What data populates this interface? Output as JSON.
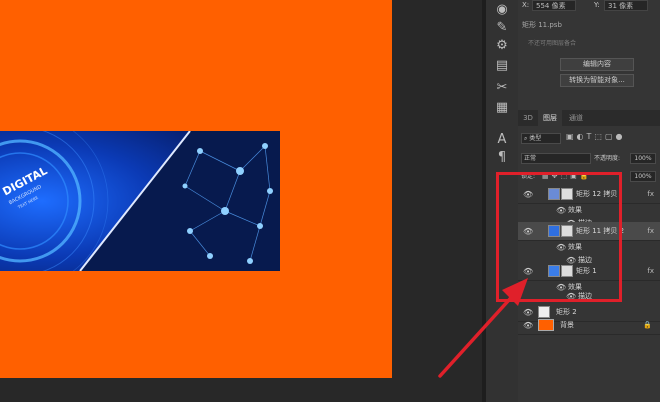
{
  "properties": {
    "x_label": "X:",
    "x_value": "554 像素",
    "y_label": "Y:",
    "y_value": "31 像素",
    "smart_object_name": "矩形 11.psb",
    "link_hint": "不还可用图层备合",
    "edit_contents_button": "编辑内容",
    "convert_button": "转换为智能对象..."
  },
  "layers_panel": {
    "tabs": [
      "3D",
      "图层",
      "通道"
    ],
    "active_tab": "图层",
    "filter_label": "类型",
    "blend_mode": "正常",
    "opacity_label": "不透明度:",
    "opacity_value": "100%",
    "lock_label": "锁定:",
    "fill_value": "100%",
    "layers": [
      {
        "name": "矩形 12 拷贝",
        "effects_label": "效果",
        "effect": "描边",
        "fx": "fx",
        "selected": false
      },
      {
        "name": "矩形 11 拷贝 2",
        "effects_label": "效果",
        "effect": "描边",
        "fx": "fx",
        "selected": true
      },
      {
        "name": "矩形 1",
        "effects_label": "效果",
        "effect": "描边",
        "fx": "fx",
        "selected": false
      },
      {
        "name": "矩形 2",
        "selected": false
      },
      {
        "name": "背景",
        "selected": false
      }
    ]
  },
  "banner": {
    "line1": "DIGITAL",
    "line2": "BACKGROUND",
    "line3": "TEXT HERE"
  },
  "colors": {
    "artboard": "#ff6000",
    "highlight": "#e0202a",
    "arrow": "#e0202a"
  }
}
